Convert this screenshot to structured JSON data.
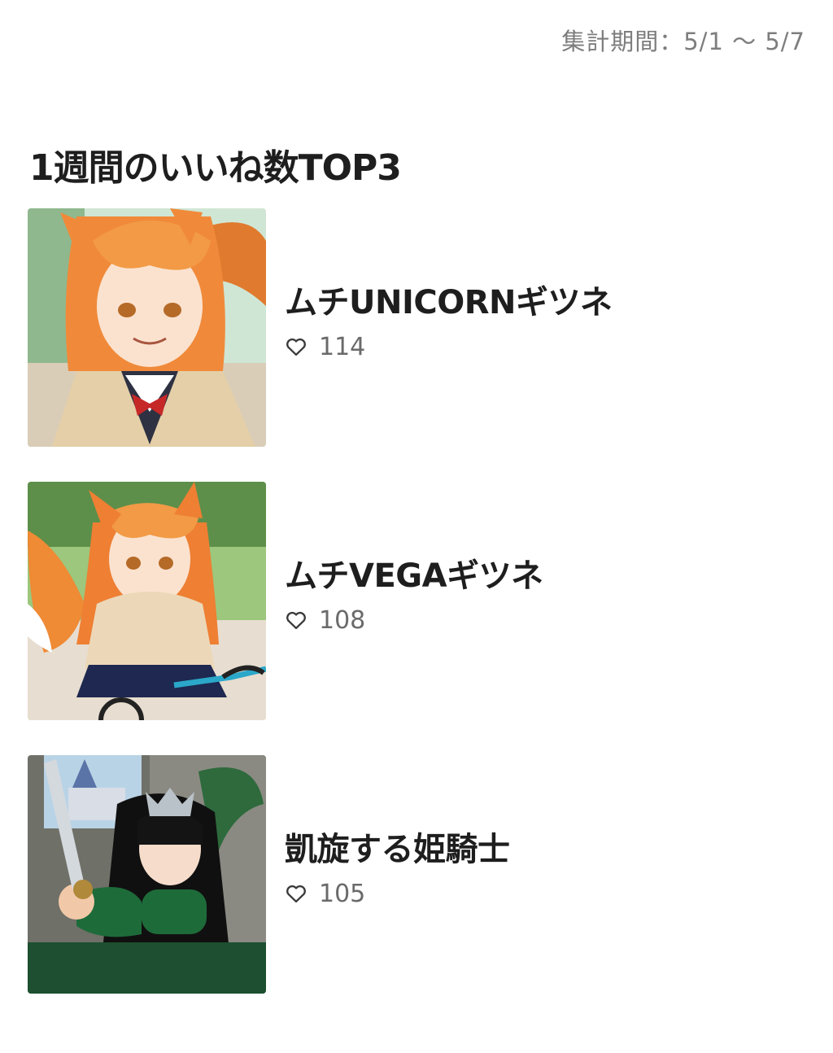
{
  "header": {
    "period_label": "集計期間：5/1 〜 5/7"
  },
  "section": {
    "title": "1週間のいいね数TOP3"
  },
  "ranking": [
    {
      "title": "ムチUNICORNギツネ",
      "likes": "114",
      "thumbnail_alt": "orange-haired fox girl in beige cardigan"
    },
    {
      "title": "ムチVEGAギツネ",
      "likes": "108",
      "thumbnail_alt": "orange-haired fox girl riding a bicycle"
    },
    {
      "title": "凱旋する姫騎士",
      "likes": "105",
      "thumbnail_alt": "black-haired princess knight in green armor with castle"
    }
  ],
  "icons": {
    "like": "heart-outline-icon"
  },
  "colors": {
    "text": "#1e1e1e",
    "muted": "#7d7d7d",
    "count": "#6a6a6a"
  }
}
